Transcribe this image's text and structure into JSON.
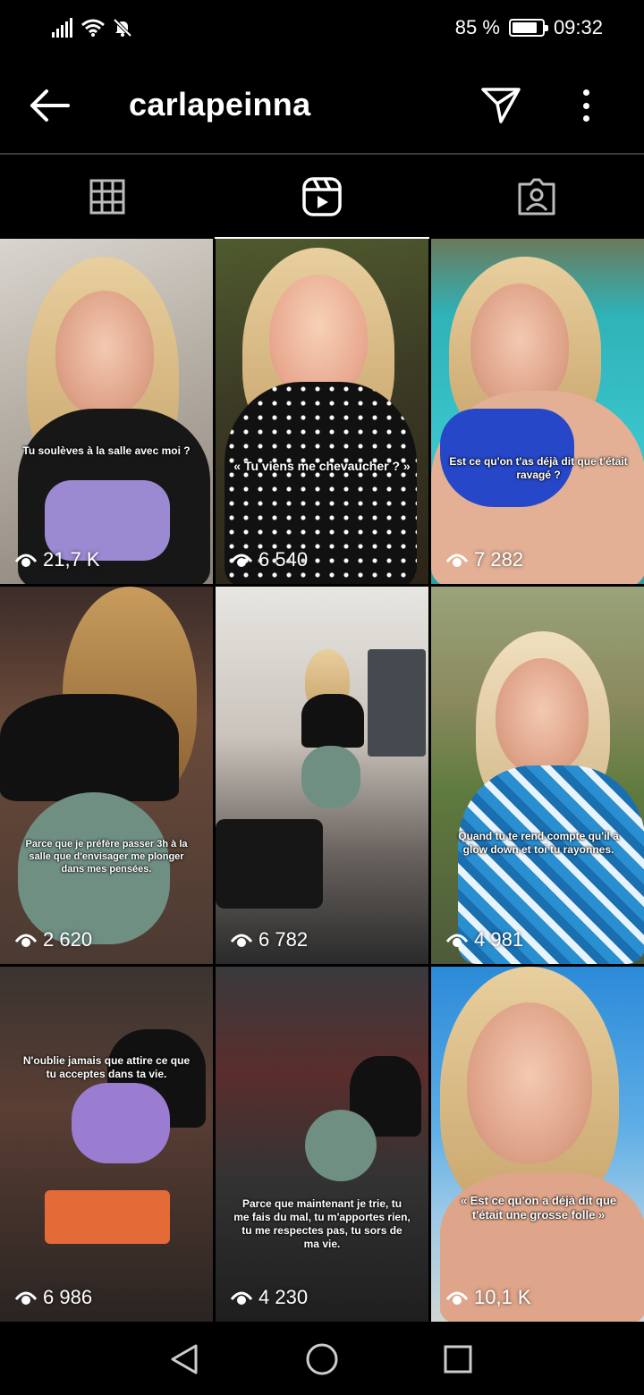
{
  "status": {
    "battery": "85 %",
    "battery_level": 0.85,
    "time": "09:32",
    "icons": [
      "signal-icon",
      "wifi-icon",
      "mute-bell-icon"
    ]
  },
  "header": {
    "username": "carlapeinna",
    "back_icon": "arrow-left-icon",
    "send_icon": "paper-plane-icon",
    "more_icon": "more-vertical-icon"
  },
  "tabs": [
    {
      "name": "grid-tab",
      "icon": "grid-icon",
      "active": false
    },
    {
      "name": "reels-tab",
      "icon": "reels-icon",
      "active": true
    },
    {
      "name": "tagged-tab",
      "icon": "tagged-person-icon",
      "active": false
    }
  ],
  "reels": [
    {
      "caption": "Tu soulèves à la salle avec moi ?",
      "views": "21,7 K"
    },
    {
      "caption": "« Tu viens me chevaucher ? »",
      "views": "6 540"
    },
    {
      "caption": "Est ce qu'on t'as déjà dit que t'était ravagé ?",
      "views": "7 282"
    },
    {
      "caption": "Parce que je préfère passer 3h à la salle que d'envisager me plonger dans mes pensées.",
      "views": "2 620"
    },
    {
      "caption": "",
      "views": "6 782"
    },
    {
      "caption": "Quand tu te rend compte qu'il a glow down et toi tu rayonnes.",
      "views": "4 981"
    },
    {
      "caption": "N'oublie jamais que attire ce que tu acceptes dans ta vie.",
      "views": "6 986"
    },
    {
      "caption": "Parce que maintenant je trie, tu me fais du mal, tu m'apportes rien, tu me respectes pas, tu sors de ma vie.",
      "views": "4 230"
    },
    {
      "caption": "« Est ce qu'on a déjà dit que t'était une grosse folle »",
      "views": "10,1 K"
    }
  ],
  "navbar": {
    "back_icon": "triangle-back-icon",
    "home_icon": "circle-home-icon",
    "recents_icon": "square-recents-icon"
  }
}
